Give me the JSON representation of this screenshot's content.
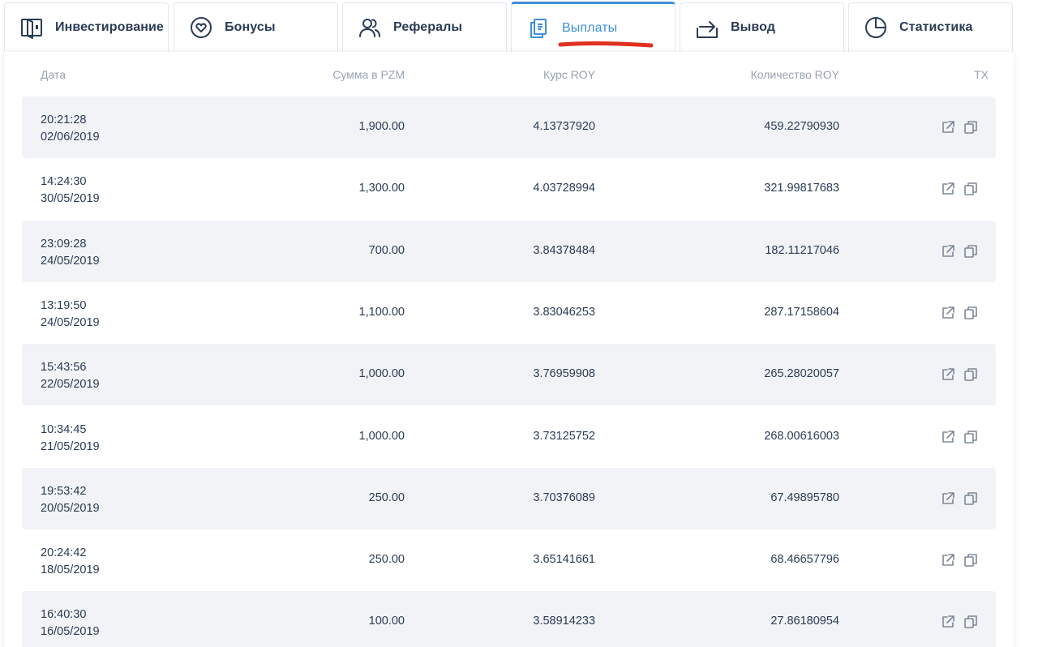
{
  "tabs": [
    {
      "label": "Инвестирование",
      "icon": "wallet-icon",
      "active": false
    },
    {
      "label": "Бонусы",
      "icon": "gift-heart-icon",
      "active": false
    },
    {
      "label": "Рефералы",
      "icon": "users-icon",
      "active": false
    },
    {
      "label": "Выплаты",
      "icon": "payments-icon",
      "active": true
    },
    {
      "label": "Вывод",
      "icon": "withdraw-icon",
      "active": false
    },
    {
      "label": "Статистика",
      "icon": "pie-chart-icon",
      "active": false
    }
  ],
  "colors": {
    "accent": "#3d8fd9",
    "text": "#2a3b55",
    "muted": "#97a2b4",
    "row_shade": "#f1f3f6",
    "annotation": "#e03020"
  },
  "table": {
    "headers": {
      "date": "Дата",
      "sum": "Сумма в PZM",
      "rate": "Курс ROY",
      "qty": "Количество ROY",
      "tx": "TX"
    },
    "row_actions": [
      "external-link-icon",
      "copy-icon"
    ],
    "rows": [
      {
        "time": "20:21:28",
        "date": "02/06/2019",
        "sum": "1,900.00",
        "rate": "4.13737920",
        "qty": "459.22790930"
      },
      {
        "time": "14:24:30",
        "date": "30/05/2019",
        "sum": "1,300.00",
        "rate": "4.03728994",
        "qty": "321.99817683"
      },
      {
        "time": "23:09:28",
        "date": "24/05/2019",
        "sum": "700.00",
        "rate": "3.84378484",
        "qty": "182.11217046"
      },
      {
        "time": "13:19:50",
        "date": "24/05/2019",
        "sum": "1,100.00",
        "rate": "3.83046253",
        "qty": "287.17158604"
      },
      {
        "time": "15:43:56",
        "date": "22/05/2019",
        "sum": "1,000.00",
        "rate": "3.76959908",
        "qty": "265.28020057"
      },
      {
        "time": "10:34:45",
        "date": "21/05/2019",
        "sum": "1,000.00",
        "rate": "3.73125752",
        "qty": "268.00616003"
      },
      {
        "time": "19:53:42",
        "date": "20/05/2019",
        "sum": "250.00",
        "rate": "3.70376089",
        "qty": "67.49895780"
      },
      {
        "time": "20:24:42",
        "date": "18/05/2019",
        "sum": "250.00",
        "rate": "3.65141661",
        "qty": "68.46657796"
      },
      {
        "time": "16:40:30",
        "date": "16/05/2019",
        "sum": "100.00",
        "rate": "3.58914233",
        "qty": "27.86180954"
      }
    ]
  }
}
